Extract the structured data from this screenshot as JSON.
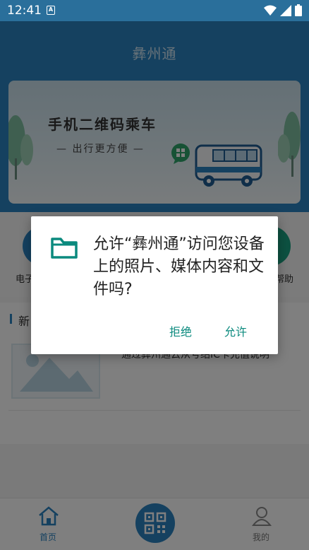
{
  "status_bar": {
    "time": "12:41",
    "notification_glyph": "A",
    "icons": [
      "wifi-icon",
      "signal-icon",
      "battery-icon"
    ]
  },
  "app": {
    "title": "彝州通"
  },
  "banner": {
    "title": "手机二维码乘车",
    "subtitle": "— 出行更方便 —"
  },
  "quick_links": [
    {
      "label": "电子",
      "icon": "card-icon",
      "color": "#2a83c0"
    },
    {
      "label": "帮助",
      "icon": "help-icon",
      "color": "#1aa383"
    }
  ],
  "news": {
    "section_title": "新",
    "items": [
      {
        "text": "通过彝州通云从号绍IC卡充值说明"
      }
    ]
  },
  "bottom_nav": {
    "home_label": "首页",
    "mine_label": "我的"
  },
  "dialog": {
    "message": "允许“彝州通”访问您设备上的照片、媒体内容和文件吗?",
    "deny_label": "拒绝",
    "allow_label": "允许"
  },
  "colors": {
    "brand_blue": "#2a83c0",
    "dialog_accent": "#0b8a7e"
  }
}
